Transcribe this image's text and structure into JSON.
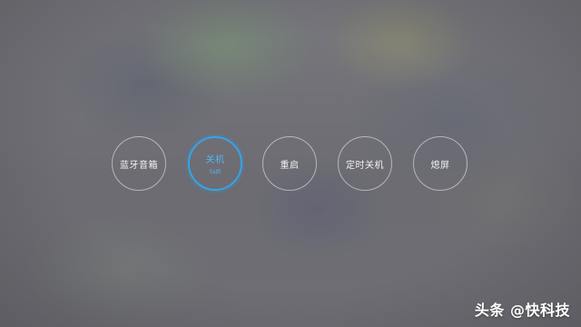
{
  "power_menu": {
    "buttons": [
      {
        "label": "蓝牙音箱"
      },
      {
        "label": "关机",
        "sub": "5s后"
      },
      {
        "label": "重启"
      },
      {
        "label": "定时关机"
      },
      {
        "label": "熄屏"
      }
    ],
    "accent_color": "#37a3e8"
  },
  "watermark": {
    "text": "头条 @快科技"
  }
}
